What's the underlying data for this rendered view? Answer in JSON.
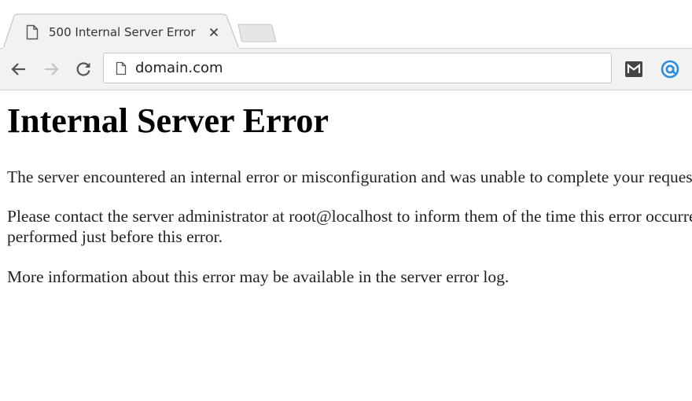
{
  "tab": {
    "title": "500 Internal Server Error",
    "page_icon": "page-icon",
    "close_icon": "close-icon"
  },
  "toolbar": {
    "back_icon": "arrow-left-icon",
    "forward_icon": "arrow-right-icon",
    "reload_icon": "reload-icon",
    "url": "domain.com",
    "extensions": [
      "gmail-m-icon",
      "at-sign-icon"
    ]
  },
  "page": {
    "heading": "Internal Server Error",
    "paragraph_1": "The server encountered an internal error or misconfiguration and was unable to complete your request.",
    "paragraph_2_line_1": "Please contact the server administrator at root@localhost to inform them of the time this error occurred, and the actions you",
    "paragraph_2_line_2": "performed just before this error.",
    "paragraph_3": "More information about this error may be available in the server error log."
  },
  "colors": {
    "extension_accent": "#2a8de0",
    "toolbar_bg": "#f2f2f2"
  }
}
